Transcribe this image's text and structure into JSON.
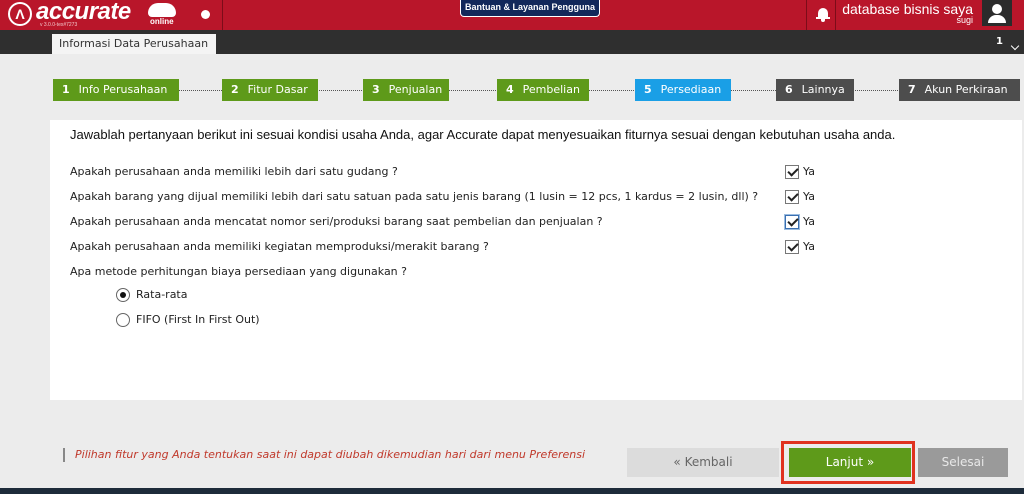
{
  "header": {
    "logo_text": "accurate",
    "logo_sub": "online",
    "version": "v 3.0.0-tex#7273",
    "help_button": "Bantuan & Layanan Pengguna",
    "database_name": "database bisnis saya",
    "username": "sugi",
    "brand_color": "#b9162a"
  },
  "tabs": {
    "active_tab": "Informasi Data Perusahaan",
    "count": "1"
  },
  "steps": [
    {
      "num": "1",
      "label": "Info Perusahaan",
      "state": "done"
    },
    {
      "num": "2",
      "label": "Fitur Dasar",
      "state": "done"
    },
    {
      "num": "3",
      "label": "Penjualan",
      "state": "done"
    },
    {
      "num": "4",
      "label": "Pembelian",
      "state": "done"
    },
    {
      "num": "5",
      "label": "Persediaan",
      "state": "active"
    },
    {
      "num": "6",
      "label": "Lainnya",
      "state": "pending"
    },
    {
      "num": "7",
      "label": "Akun Perkiraan",
      "state": "pending"
    }
  ],
  "form": {
    "intro": "Jawablah pertanyaan berikut ini sesuai kondisi usaha Anda, agar Accurate dapat menyesuaikan fiturnya sesuai dengan kebutuhan usaha anda.",
    "questions": [
      {
        "text": "Apakah perusahaan anda memiliki lebih dari satu gudang ?",
        "answer_label": "Ya",
        "checked": true
      },
      {
        "text": "Apakah barang yang dijual memiliki lebih dari satu satuan pada satu jenis barang (1 lusin = 12 pcs, 1 kardus = 2 lusin, dll) ?",
        "answer_label": "Ya",
        "checked": true
      },
      {
        "text": "Apakah perusahaan anda mencatat nomor seri/produksi barang saat pembelian dan penjualan ?",
        "answer_label": "Ya",
        "checked": true
      },
      {
        "text": "Apakah perusahaan anda memiliki kegiatan memproduksi/merakit barang ?",
        "answer_label": "Ya",
        "checked": true
      }
    ],
    "costing_question": "Apa metode perhitungan biaya persediaan yang digunakan ?",
    "costing_options": [
      {
        "label": "Rata-rata",
        "selected": true
      },
      {
        "label": "FIFO (First In First Out)",
        "selected": false
      }
    ]
  },
  "footer": {
    "note": "Pilihan fitur yang Anda tentukan saat ini dapat diubah dikemudian hari dari menu Preferensi",
    "back_button": "« Kembali",
    "next_button": "Lanjut »",
    "finish_button": "Selesai"
  }
}
